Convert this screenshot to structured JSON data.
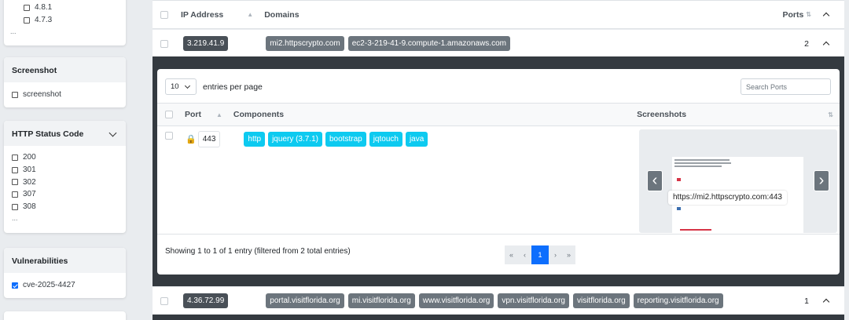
{
  "sidebar": {
    "version_options": [
      "4.8.1",
      "4.7.3"
    ],
    "version_more": "...",
    "screenshot": {
      "title": "Screenshot",
      "options": [
        "screenshot"
      ]
    },
    "http_status": {
      "title": "HTTP Status Code",
      "options": [
        "200",
        "301",
        "302",
        "307",
        "308"
      ],
      "more": "..."
    },
    "vulnerabilities": {
      "title": "Vulnerabilities",
      "options": [
        "cve-2025-4427"
      ]
    }
  },
  "table": {
    "headers": {
      "ip": "IP Address",
      "domains": "Domains",
      "ports": "Ports"
    },
    "rows": [
      {
        "ip": "3.219.41.9",
        "domains": [
          "mi2.httpscrypto.com",
          "ec2-3-219-41-9.compute-1.amazonaws.com"
        ],
        "ports": "2"
      },
      {
        "ip": "4.36.72.99",
        "domains": [
          "portal.visitflorida.org",
          "mi.visitflorida.org",
          "www.visitflorida.org",
          "vpn.visitflorida.org",
          "visitflorida.org",
          "reporting.visitflorida.org"
        ],
        "ports": "1"
      }
    ]
  },
  "ports_table": {
    "entries_value": "10",
    "entries_label": "entries per page",
    "search_placeholder": "Search Ports",
    "headers": {
      "port": "Port",
      "components": "Components",
      "screenshots": "Screenshots"
    },
    "row": {
      "port": "443",
      "components": [
        "http",
        "jquery (3.7.1)",
        "bootstrap",
        "jqtouch",
        "java"
      ],
      "screenshot_url": "https://mi2.httpscrypto.com:443"
    },
    "info": "Showing 1 to 1 of 1 entry (filtered from 2 total entries)",
    "pagination": {
      "first": "«",
      "prev": "‹",
      "current": "1",
      "next": "›",
      "last": "»"
    }
  },
  "colors": {
    "accent": "#0d6efd",
    "component": "#0dcaf0",
    "ip_badge": "#495057",
    "domain_badge": "#6c757d"
  }
}
